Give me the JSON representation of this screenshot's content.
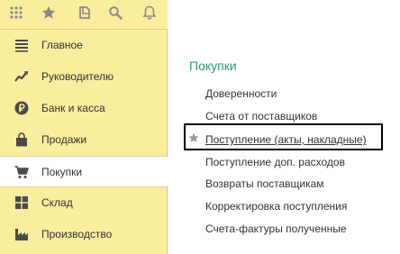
{
  "toolbar": {
    "icons": [
      "apps-grid-icon",
      "favorites-star-icon",
      "history-icon",
      "search-icon",
      "notifications-bell-icon"
    ]
  },
  "sidebar": {
    "items": [
      {
        "label": "Главное",
        "icon": "menu-lines-icon"
      },
      {
        "label": "Руководителю",
        "icon": "trend-chart-icon"
      },
      {
        "label": "Банк и касса",
        "icon": "ruble-coin-icon"
      },
      {
        "label": "Продажи",
        "icon": "shopping-bag-icon"
      },
      {
        "label": "Покупки",
        "icon": "shopping-cart-icon",
        "active": true
      },
      {
        "label": "Склад",
        "icon": "warehouse-grid-icon"
      },
      {
        "label": "Производство",
        "icon": "factory-icon"
      }
    ]
  },
  "main": {
    "section_title": "Покупки",
    "links": [
      "Доверенности",
      "Счета от поставщиков",
      "Поступление (акты, накладные)",
      "Поступление доп. расходов",
      "Возвраты поставщикам",
      "Корректировка поступления",
      "Счета-фактуры полученные"
    ],
    "highlighted_link_index": 2
  },
  "colors": {
    "sidebar_bg": "#fbed9e",
    "icon_color": "#4a4a4a",
    "toolbar_icon_color": "#8a8a8a",
    "section_title_color": "#299d6b",
    "text_color": "#333333",
    "highlight_border": "#000000"
  }
}
